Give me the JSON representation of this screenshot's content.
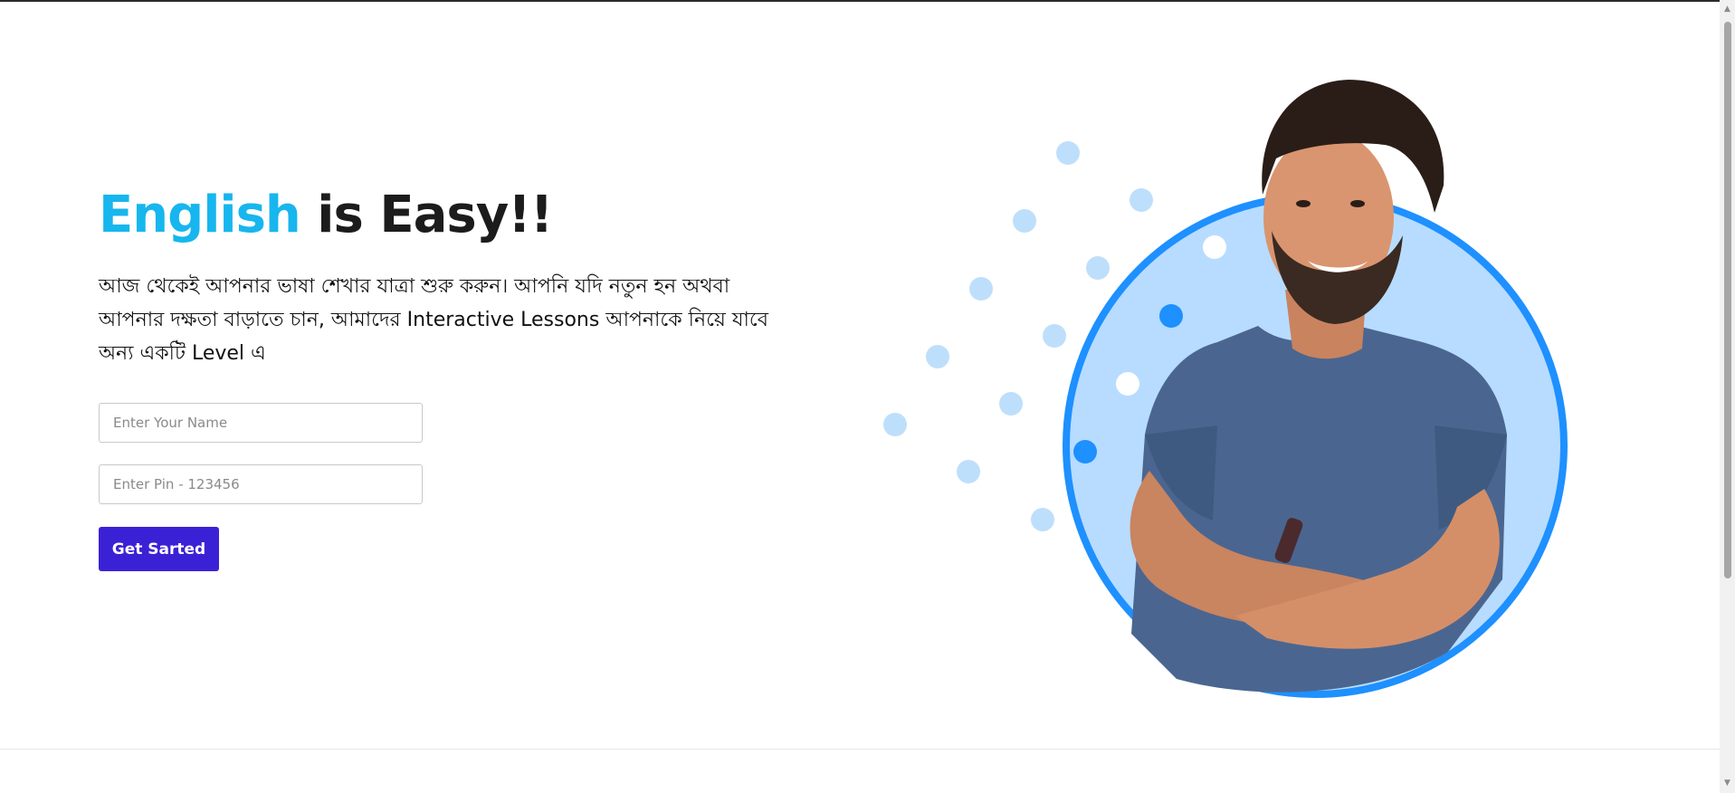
{
  "hero": {
    "title_accent": "English",
    "title_rest": " is Easy!!",
    "description": "আজ থেকেই আপনার ভাষা শেখার যাত্রা শুরু করুন। আপনি যদি নতুন হন অথবা আপনার দক্ষতা বাড়াতে চান, আমাদের Interactive Lessons আপনাকে নিয়ে যাবে অন্য একটি Level এ"
  },
  "form": {
    "name_placeholder": "Enter Your Name",
    "pin_placeholder": "Enter Pin - 123456",
    "submit_label": "Get Sarted"
  },
  "colors": {
    "accent": "#17b6ee",
    "button": "#3b21d6",
    "circle_ring": "#1e90ff",
    "circle_fill": "#b7dcff",
    "dot_light": "#bedffb",
    "dot_dark": "#1e90ff"
  },
  "illustration": {
    "icon": "smiling-man-photo"
  }
}
